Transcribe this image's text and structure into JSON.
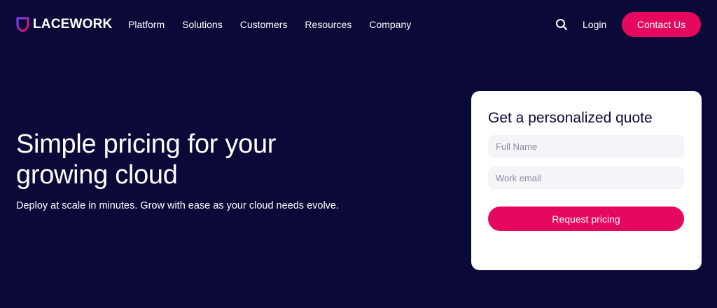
{
  "brand": {
    "name": "LACEWORK",
    "logo_icon": "shield-logo-icon",
    "logo_colors": [
      "#6d4cf5",
      "#e6085f"
    ]
  },
  "nav": {
    "items": [
      {
        "label": "Platform"
      },
      {
        "label": "Solutions"
      },
      {
        "label": "Customers"
      },
      {
        "label": "Resources"
      },
      {
        "label": "Company"
      }
    ],
    "search_icon": "search-icon",
    "login_label": "Login",
    "contact_label": "Contact Us"
  },
  "hero": {
    "title": "Simple pricing for your growing cloud",
    "subtitle": "Deploy at scale in minutes. Grow with ease as your cloud needs evolve."
  },
  "quote_form": {
    "title": "Get a personalized quote",
    "full_name": {
      "value": "",
      "placeholder": "Full Name"
    },
    "work_email": {
      "value": "",
      "placeholder": "Work email"
    },
    "submit_label": "Request pricing"
  },
  "colors": {
    "background": "#0b0938",
    "accent": "#e6085f",
    "card": "#ffffff",
    "input_bg": "#f4f5f9"
  }
}
